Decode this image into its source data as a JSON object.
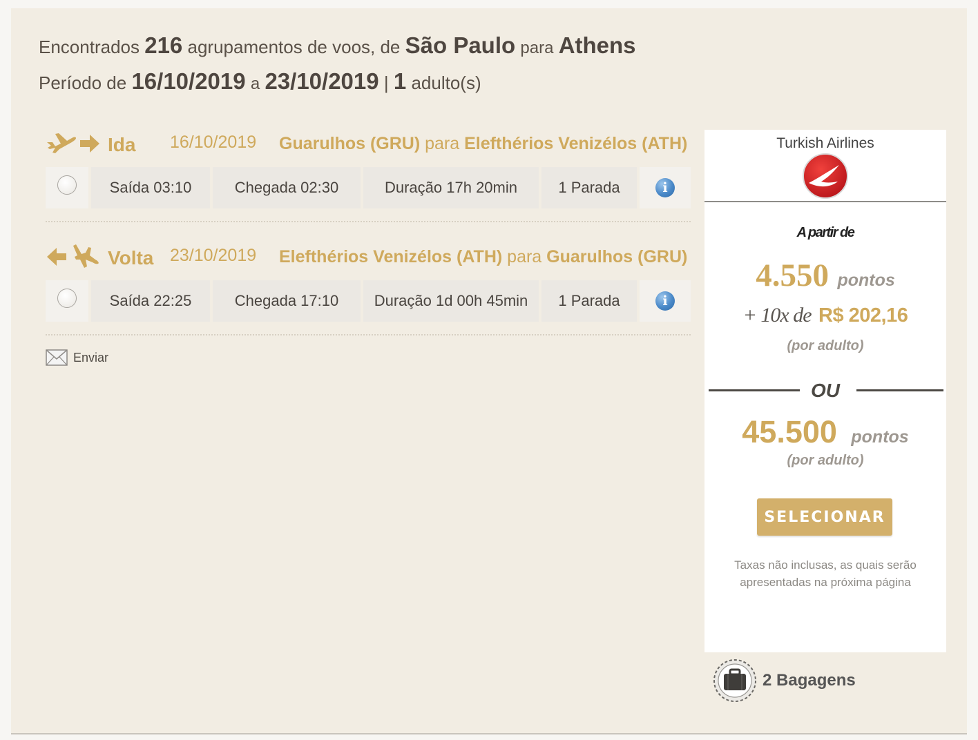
{
  "summary": {
    "line1_pre": "Encontrados",
    "count": "216",
    "line1_mid": "agrupamentos de voos, de",
    "origin": "São Paulo",
    "line1_para": "para",
    "destination": "Athens",
    "line2_pre": "Período de",
    "date_from": "16/10/2019",
    "line2_a": "a",
    "date_to": "23/10/2019",
    "sep": "|",
    "adults_count": "1",
    "adults_label": "adulto(s)"
  },
  "legs": [
    {
      "label": "Ida",
      "date": "16/10/2019",
      "from": "Guarulhos (GRU)",
      "para": "para",
      "to": "Elefthérios Venizélos (ATH)",
      "saida": "Saída 03:10",
      "chegada": "Chegada 02:30",
      "duracao": "Duração 17h 20min",
      "paradas": "1 Parada"
    },
    {
      "label": "Volta",
      "date": "23/10/2019",
      "from": "Elefthérios Venizélos (ATH)",
      "para": "para",
      "to": "Guarulhos (GRU)",
      "saida": "Saída 22:25",
      "chegada": "Chegada 17:10",
      "duracao": "Duração 1d 00h 45min",
      "paradas": "1 Parada"
    }
  ],
  "enviar_label": "Enviar",
  "offer": {
    "airline": "Turkish Airlines",
    "a_partir": "A partir de",
    "points_mixed": "4.550",
    "points_unit": "pontos",
    "installments": "+ 10x de",
    "installment_value": "R$ 202,16",
    "per_adult": "(por adulto)",
    "ou": "OU",
    "points_full": "45.500",
    "points_full_unit": "pontos",
    "per_adult_2": "(por adulto)",
    "select_label": "SELECIONAR",
    "taxes_note": "Taxas não inclusas, as quais serão apresentadas na próxima página"
  },
  "baggage": "2 Bagagens",
  "colors": {
    "gold": "#cfa95c",
    "panel_bg": "#f2ede3",
    "info_blue": "#4a89c8"
  }
}
